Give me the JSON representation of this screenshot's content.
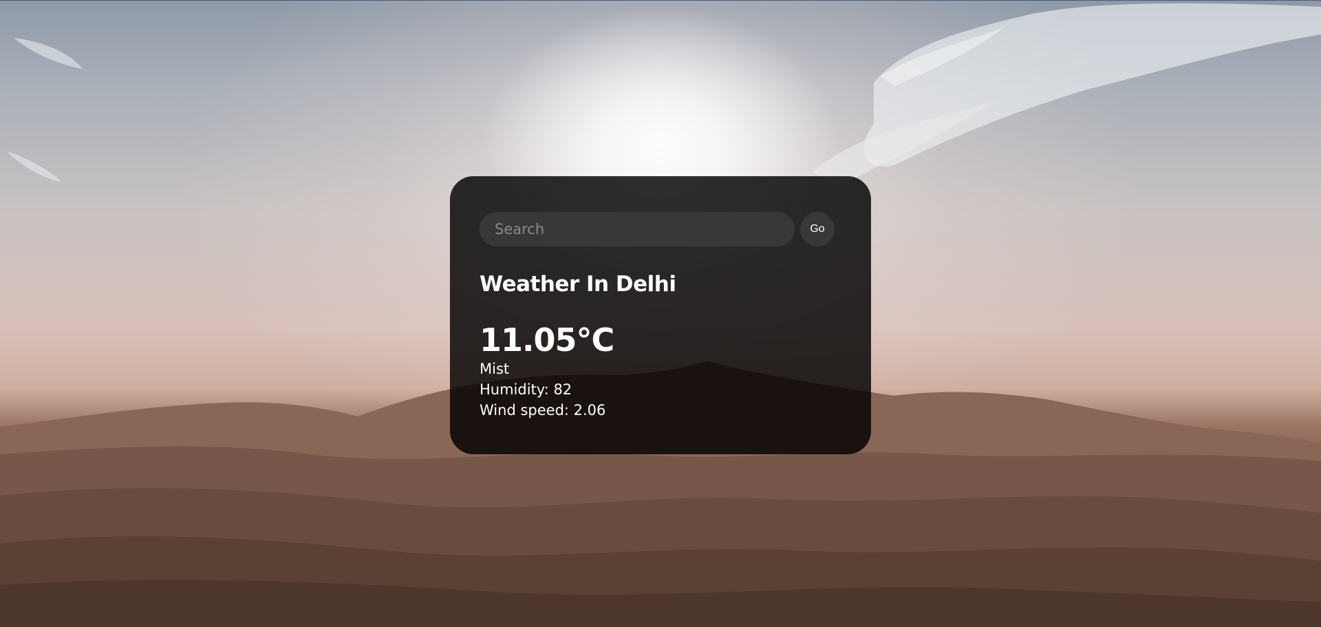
{
  "search": {
    "placeholder": "Search",
    "value": "",
    "button_label": "Go"
  },
  "weather": {
    "title": "Weather In Delhi",
    "temperature": "11.05°C",
    "description": "Mist",
    "humidity": "Humidity: 82",
    "wind_speed": "Wind speed: 2.06"
  },
  "colors": {
    "card_background": "#1e1e1e",
    "input_background": "#383838",
    "text": "#ffffff",
    "placeholder": "#8a8a8a"
  },
  "background": {
    "scene": "desert-dunes-with-sun"
  }
}
